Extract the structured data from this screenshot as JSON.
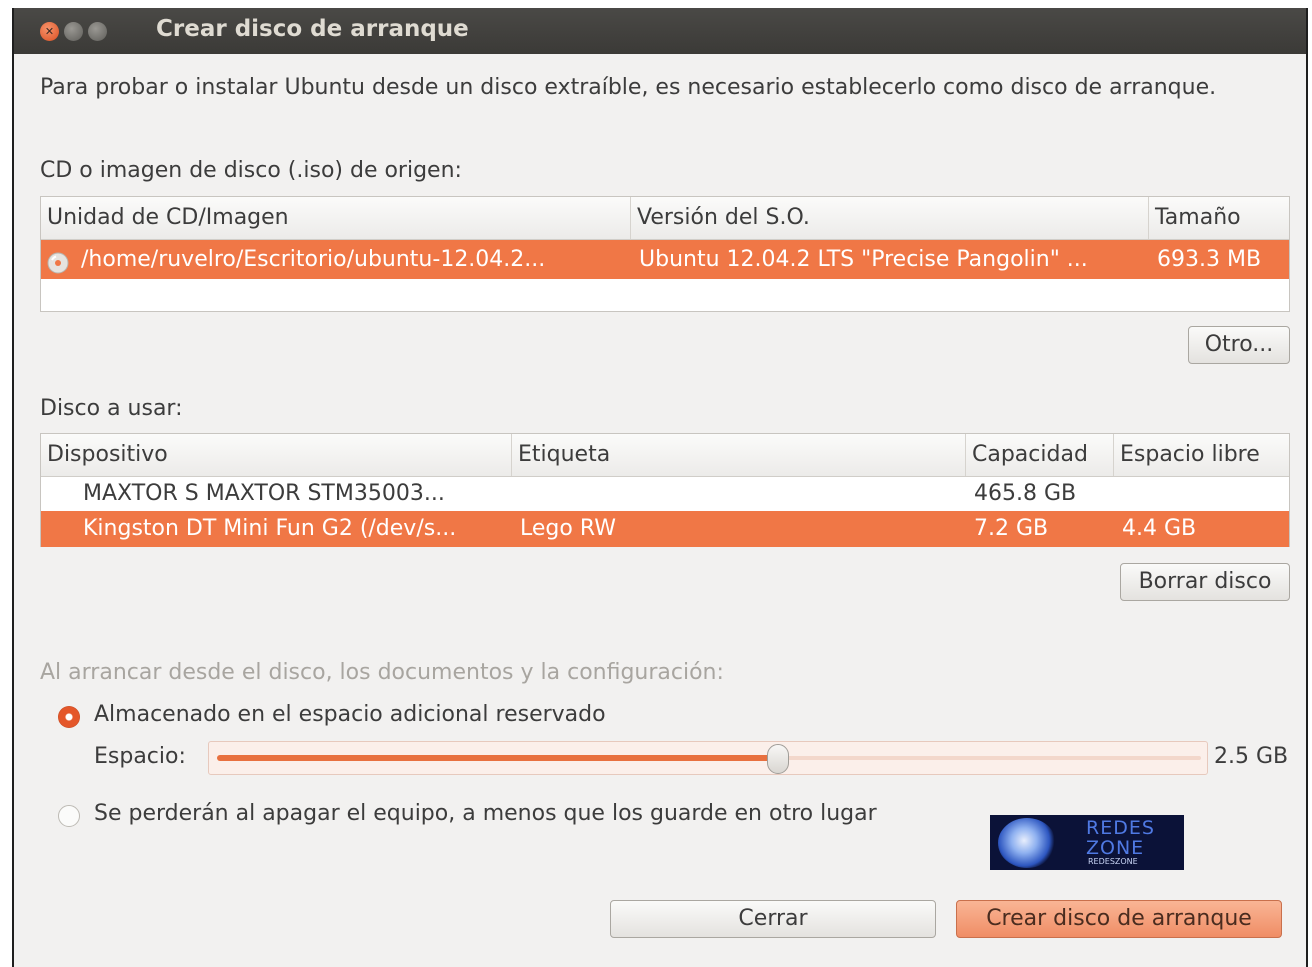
{
  "window": {
    "title": "Crear disco de arranque"
  },
  "intro": "Para probar o instalar Ubuntu desde un disco extraíble, es necesario establecerlo como disco de arranque.",
  "source": {
    "label": "CD o imagen de disco (.iso) de origen:",
    "columns": [
      "Unidad de CD/Imagen",
      "Versión del S.O.",
      "Tamaño"
    ],
    "rows": [
      {
        "path": "/home/ruvelro/Escritorio/ubuntu-12.04.2...",
        "version": "Ubuntu 12.04.2 LTS \"Precise Pangolin\" ...",
        "size": "693.3 MB",
        "selected": true,
        "icon": "cd-icon"
      }
    ],
    "other_button": "Otro..."
  },
  "disk": {
    "label": "Disco a usar:",
    "columns": [
      "Dispositivo",
      "Etiqueta",
      "Capacidad",
      "Espacio libre"
    ],
    "rows": [
      {
        "device": "MAXTOR S MAXTOR STM35003...",
        "label": "",
        "capacity": "465.8 GB",
        "free": "",
        "selected": false
      },
      {
        "device": "Kingston DT Mini Fun G2 (/dev/s...",
        "label": "Lego RW",
        "capacity": "7.2 GB",
        "free": "4.4 GB",
        "selected": true
      }
    ],
    "erase_button": "Borrar disco"
  },
  "persistence": {
    "label": "Al arrancar desde el disco, los documentos y la configuración:",
    "option_store": "Almacenado en el espacio adicional reservado",
    "space_label": "Espacio:",
    "space_value": "2.5 GB",
    "slider_fraction": 0.57,
    "option_lose": "Se perderán al apagar el equipo, a menos que los guarde en otro lugar",
    "selected_option": "store"
  },
  "logo": {
    "line1": "REDES",
    "line2": "ZONE",
    "line3": "REDESZONE"
  },
  "buttons": {
    "close": "Cerrar",
    "create": "Crear disco de arranque"
  },
  "colors": {
    "accent": "#f07746",
    "titlebar": "#3f3e3b",
    "close_button": "#e2572a"
  }
}
